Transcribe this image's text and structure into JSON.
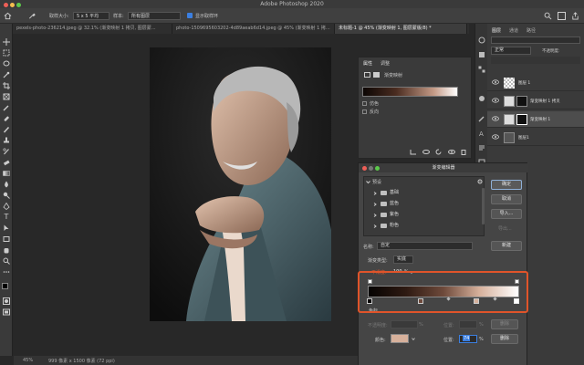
{
  "app": {
    "title": "Adobe Photoshop 2020"
  },
  "options_bar": {
    "sample_size_label": "取样大小:",
    "sample_size_value": "5 x 5 平均",
    "sample_label": "样本:",
    "sample_value": "所有图层",
    "show_ring_label": "显示取样环"
  },
  "tabs": [
    {
      "label": "pexels-photo-236214.jpeg @ 32.1% (渐变映射 1 拷贝, 图层蒙...",
      "active": false
    },
    {
      "label": "photo-1509695603202-4d89aeab6d14.jpeg @ 45% (渐变映射 1 拷...",
      "active": false
    },
    {
      "label": "未标题-1 @ 45% (渐变映射 1, 图层蒙版/8) *",
      "active": true
    }
  ],
  "status": {
    "zoom": "45%",
    "doc_info": "999 像素 x 1500 像素 (72 ppi)"
  },
  "layers_panel": {
    "tabs": [
      "图层",
      "通道",
      "路径"
    ],
    "kind_label": "正常",
    "opacity_label": "不透明度:",
    "layers": [
      {
        "name": "图层 1",
        "selected": false
      },
      {
        "name": "渐变映射 1 拷贝",
        "selected": false
      },
      {
        "name": "渐变映射 1",
        "selected": true
      },
      {
        "name": "图层1",
        "selected": false
      }
    ]
  },
  "properties_panel": {
    "tabs": [
      "属性",
      "调整"
    ],
    "section": "渐变映射",
    "dither_label": "仿色",
    "reverse_label": "反向"
  },
  "gradient_editor": {
    "title": "渐变编辑器",
    "presets_label": "预设",
    "folders": [
      "基础",
      "蓝色",
      "紫色",
      "粉色"
    ],
    "ok": "确定",
    "cancel": "取消",
    "import": "导入...",
    "export": "导出...",
    "name_label": "名称:",
    "name_value": "自定",
    "new": "新建",
    "type_label": "渐变类型:",
    "type_value": "实底",
    "smoothness_label": "平滑度:",
    "smoothness_value": "100",
    "percent": "%",
    "color_section": "色标",
    "opacity_label": "不透明度:",
    "position_label": "位置:",
    "delete": "删除",
    "color_label": "颜色:",
    "color_position_value": "74",
    "stop_color": "#d7b19c"
  }
}
